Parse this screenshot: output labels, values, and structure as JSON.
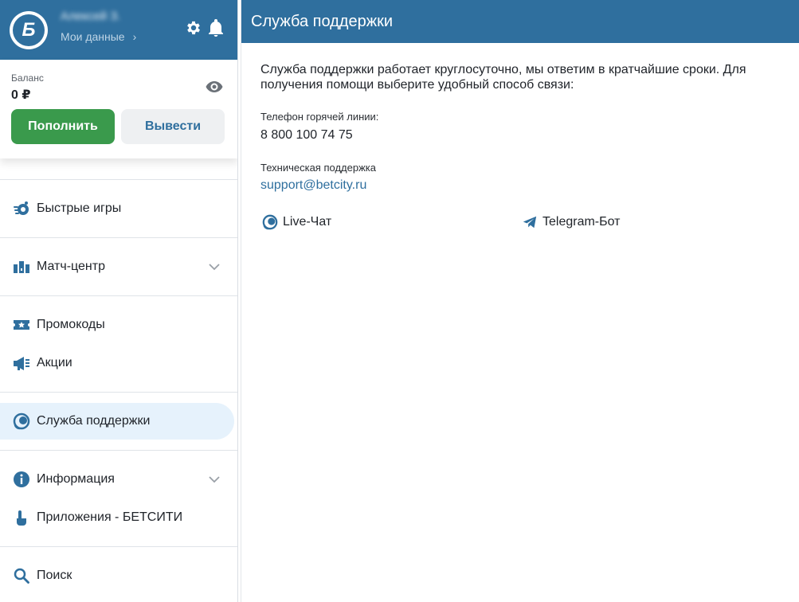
{
  "user": {
    "name": "Алексей З.",
    "my_data_label": "Мои данные",
    "chevron": "›"
  },
  "balance": {
    "label": "Баланс",
    "value": "0 ₽",
    "deposit_label": "Пополнить",
    "withdraw_label": "Вывести"
  },
  "menu": [
    {
      "id": "quick-games",
      "label": "Быстрые игры",
      "icon": "quick-games-icon"
    },
    {
      "id": "match-center",
      "label": "Матч-центр",
      "icon": "stadium-icon"
    },
    {
      "id": "promocodes",
      "label": "Промокоды",
      "icon": "ticket-star-icon"
    },
    {
      "id": "promotions",
      "label": "Акции",
      "icon": "megaphone-icon"
    },
    {
      "id": "support",
      "label": "Служба поддержки",
      "icon": "headset-chat-icon"
    },
    {
      "id": "info",
      "label": "Информация",
      "icon": "info-icon"
    },
    {
      "id": "apps",
      "label": "Приложения - БЕТСИТИ",
      "icon": "tap-hand-icon"
    },
    {
      "id": "search",
      "label": "Поиск",
      "icon": "search-icon"
    }
  ],
  "main": {
    "title": "Служба поддержки",
    "intro": "Служба поддержки работает круглосуточно, мы ответим в кратчайшие сроки. Для получения помощи выберите удобный способ связи:",
    "hotline_label": "Телефон горячей линии:",
    "hotline_value": "8 800 100 74 75",
    "tech_label": "Техническая поддержка",
    "tech_email": "support@betcity.ru",
    "live_chat_label": "Live-Чат",
    "telegram_label": "Telegram-Бот"
  },
  "colors": {
    "brand": "#2f6f9e",
    "green": "#3a9a4c",
    "active_bg": "#e6f2fc"
  }
}
